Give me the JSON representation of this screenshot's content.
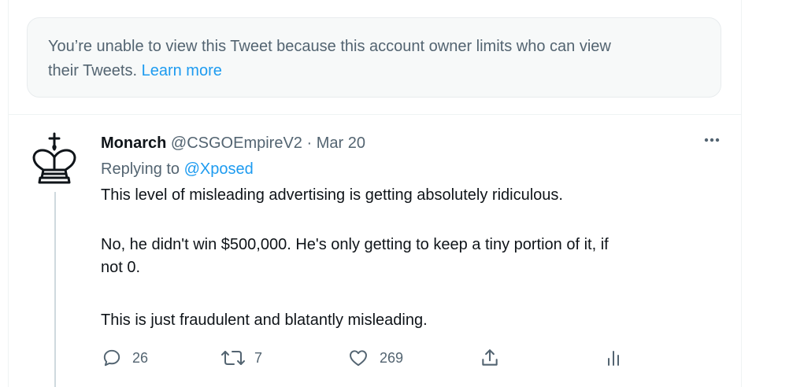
{
  "notice": {
    "text": "You’re unable to view this Tweet because this account owner limits who can view their Tweets.",
    "line1": "You’re unable to view this Tweet because this account owner limits who can view",
    "line2": "their Tweets.",
    "link": "Learn more"
  },
  "tweet": {
    "author_name": "Monarch",
    "handle": "@CSGOEmpireV2",
    "separator": "·",
    "date": "Mar 20",
    "replying_label": "Replying to",
    "replying_handle": "@Xposed",
    "lines": [
      "This level of misleading advertising is getting absolutely ridiculous.",
      "No, he didn't win $500,000. He's only getting to keep a tiny portion of it, if",
      "not 0.",
      "This is just fraudulent and blatantly misleading."
    ],
    "replies": "26",
    "retweets": "7",
    "likes": "269"
  },
  "icons": {
    "avatar": "chess-king-avatar",
    "more": "more-icon",
    "reply": "reply-icon",
    "retweet": "retweet-icon",
    "like": "heart-icon",
    "share": "share-icon",
    "analytics": "analytics-icon"
  },
  "colors": {
    "accent": "#1d9bf0",
    "secondary_text": "#536471",
    "notice_bg": "#f7f9f9"
  }
}
